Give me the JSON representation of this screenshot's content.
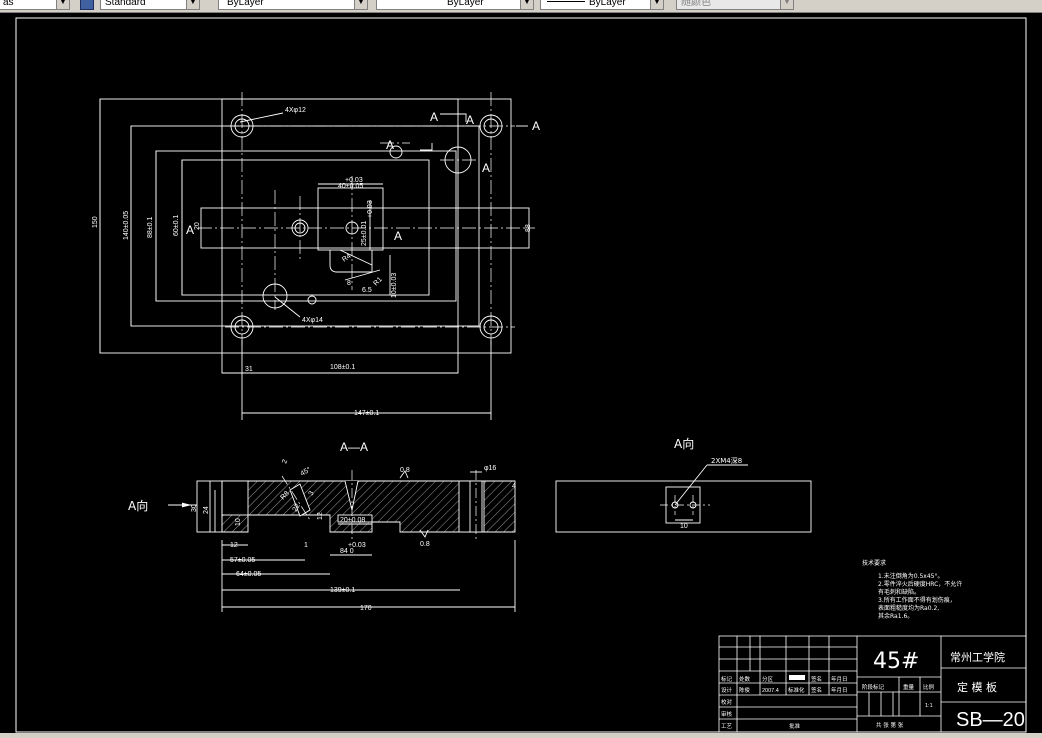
{
  "toolbar": {
    "partial_first": "as",
    "text_style": "Standard",
    "layer": "ByLayer",
    "linetype": "ByLayer",
    "lineweight": "ByLayer",
    "plot_style": "随颜色"
  },
  "drawing": {
    "plan_view": {
      "hole_4x12": "4Xφ12",
      "hole_4x14": "4Xφ14",
      "section_letter": "A",
      "view_arrow_A": "A",
      "dim_150": "150",
      "dim_vert_2": "140±0.05",
      "dim_vert_3": "88±0.1",
      "dim_vert_4": "60±0.1",
      "dim_20": "20",
      "dim_40": "40±0.05",
      "dim_plus": "+0.03",
      "dim_r4": "R4",
      "dim_8": "8",
      "dim_6": "6",
      "dim_6r": "6.5",
      "dim_r1": "R1",
      "dim_25": "25",
      "dim_25r": "25±0.01",
      "dim_10": "10±0.03",
      "dim_r01": "R0.1",
      "dim_14": "14",
      "dim_31": "31",
      "dim_108": "108±0.1",
      "dim_147": "147±0.1",
      "dim_88": "88"
    },
    "section_view": {
      "title": "A—A",
      "view_label": "A向",
      "dim_30": "30",
      "dim_24": "24",
      "dim_10": "10",
      "dim_12": "12",
      "dim_57": "57±0.05",
      "dim_64": "64±0.05",
      "dim_84": "84  0",
      "dim_plus": "+0.03",
      "dim_20_108": "20±0.08",
      "dim_1": "1",
      "dim_139": "139±0.1",
      "dim_170": "170",
      "rough_08": "0.8",
      "rough_08b": "0.8",
      "dim_16": "φ16",
      "dim_f4": "4",
      "dim_12r": "12",
      "dim_2": "2",
      "dim_3": "3",
      "dim_45": "45°",
      "dim_r8": "R8",
      "dim_22": "22",
      "dim_12b": "12"
    },
    "view_A": {
      "title": "A向",
      "note": "2XM4深8",
      "dim_10": "10"
    },
    "tech_requirements": {
      "title": "技术要求",
      "lines": [
        "1.未注倒角为0.5x45°。",
        "2.零件淬火后硬度HRC，不允许",
        "  有毛刺和缺陷。",
        "3.所有工作面不得有划伤痕，",
        "  表面粗糙度均为Ra0.2,",
        "  其余Ra1.6。"
      ]
    },
    "title_block": {
      "material": "45#",
      "school": "常州工学院",
      "part_name": "定 模 板",
      "drawing_no": "SB—20",
      "rev_headers": [
        "标记",
        "处数",
        "分区",
        "",
        "签名",
        "年月日"
      ],
      "row_design": [
        "设计",
        "陈俊",
        "2007.4",
        "标准化",
        "签名",
        "年月日"
      ],
      "row_check": "校对",
      "row_review": "审核",
      "row_process": "工艺",
      "row_approve": "批准",
      "stage_label": "阶段标记",
      "weight_label": "重量",
      "scale_label": "比例",
      "scale_value": "1:1",
      "sheets": "共 张  第 张"
    }
  }
}
